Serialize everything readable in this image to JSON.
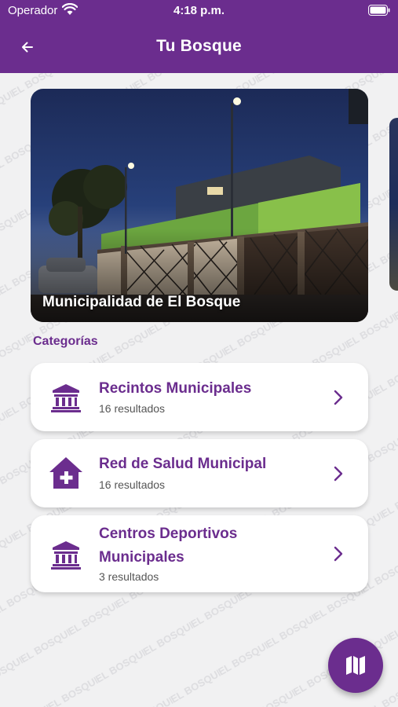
{
  "status_bar": {
    "carrier": "Operador",
    "time": "4:18 p.m.",
    "wifi_icon": "wifi-icon",
    "battery_icon": "battery-icon"
  },
  "header": {
    "title": "Tu Bosque",
    "back_icon": "arrow-left-icon",
    "background": "#6b2d8e"
  },
  "watermark_text": "EL BOSQUE",
  "hero": {
    "caption": "Municipalidad de El Bosque"
  },
  "categories_label": "Categorías",
  "categories": [
    {
      "title": "Recintos Municipales",
      "count": "16 resultados",
      "icon": "institution-icon"
    },
    {
      "title": "Red de Salud Municipal",
      "count": "16 resultados",
      "icon": "health-house-icon"
    },
    {
      "title": "Centros Deportivos Municipales",
      "count": "3 resultados",
      "icon": "institution-icon"
    }
  ],
  "fab": {
    "icon": "map-icon"
  },
  "colors": {
    "accent": "#6b2d8e",
    "background": "#f1f1f2"
  }
}
